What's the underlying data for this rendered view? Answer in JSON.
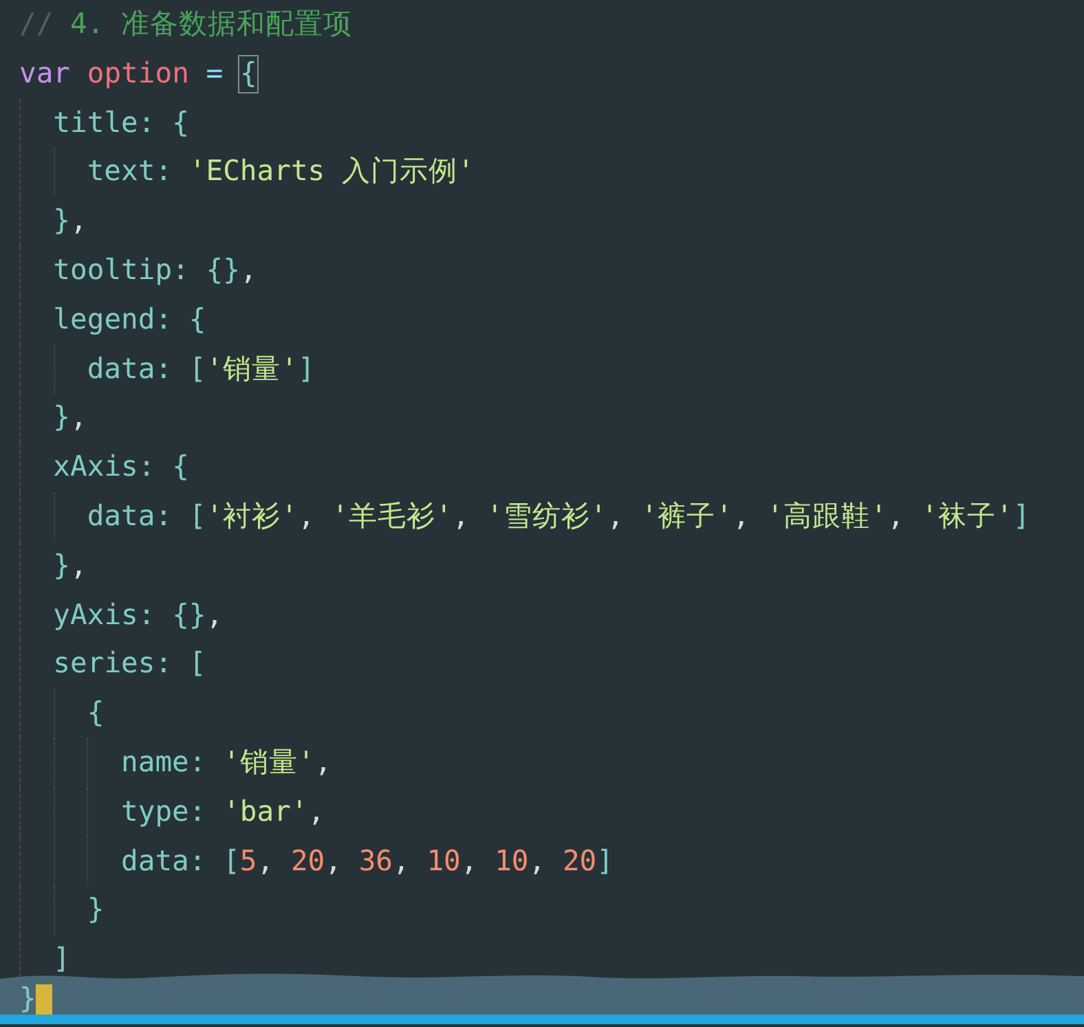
{
  "editor": {
    "lines": [
      {
        "tokens": [
          {
            "kind": "comment-mark",
            "text": "// "
          },
          {
            "kind": "comment",
            "text": "4. 准备数据和配置项"
          }
        ]
      },
      {
        "tokens": [
          {
            "kind": "keyword",
            "text": "var "
          },
          {
            "kind": "variable",
            "text": "option "
          },
          {
            "kind": "operator",
            "text": "= "
          },
          {
            "kind": "bracket",
            "text": "{",
            "highlighted": true
          }
        ],
        "children": [
          {
            "tokens": [
              {
                "kind": "property",
                "text": "title: "
              },
              {
                "kind": "bracket",
                "text": "{"
              }
            ],
            "children": [
              {
                "tokens": [
                  {
                    "kind": "property",
                    "text": "text: "
                  },
                  {
                    "kind": "string",
                    "text": "'ECharts 入门示例'"
                  }
                ]
              }
            ]
          },
          {
            "tokens": [
              {
                "kind": "bracket",
                "text": "}"
              },
              {
                "kind": "punct",
                "text": ","
              }
            ]
          },
          {
            "tokens": [
              {
                "kind": "property",
                "text": "tooltip: "
              },
              {
                "kind": "bracket",
                "text": "{}"
              },
              {
                "kind": "punct",
                "text": ","
              }
            ]
          },
          {
            "tokens": [
              {
                "kind": "property",
                "text": "legend: "
              },
              {
                "kind": "bracket",
                "text": "{"
              }
            ],
            "children": [
              {
                "tokens": [
                  {
                    "kind": "property",
                    "text": "data: "
                  },
                  {
                    "kind": "bracket",
                    "text": "["
                  },
                  {
                    "kind": "string",
                    "text": "'销量'"
                  },
                  {
                    "kind": "bracket",
                    "text": "]"
                  }
                ]
              }
            ]
          },
          {
            "tokens": [
              {
                "kind": "bracket",
                "text": "}"
              },
              {
                "kind": "punct",
                "text": ","
              }
            ]
          },
          {
            "tokens": [
              {
                "kind": "property",
                "text": "xAxis: "
              },
              {
                "kind": "bracket",
                "text": "{"
              }
            ],
            "children": [
              {
                "tokens": [
                  {
                    "kind": "property",
                    "text": "data: "
                  },
                  {
                    "kind": "bracket",
                    "text": "["
                  },
                  {
                    "kind": "string",
                    "text": "'衬衫'"
                  },
                  {
                    "kind": "punct",
                    "text": ", "
                  },
                  {
                    "kind": "string",
                    "text": "'羊毛衫'"
                  },
                  {
                    "kind": "punct",
                    "text": ", "
                  },
                  {
                    "kind": "string",
                    "text": "'雪纺衫'"
                  },
                  {
                    "kind": "punct",
                    "text": ", "
                  },
                  {
                    "kind": "string",
                    "text": "'裤子'"
                  },
                  {
                    "kind": "punct",
                    "text": ", "
                  },
                  {
                    "kind": "string",
                    "text": "'高跟鞋'"
                  },
                  {
                    "kind": "punct",
                    "text": ", "
                  },
                  {
                    "kind": "string",
                    "text": "'袜子'"
                  },
                  {
                    "kind": "bracket",
                    "text": "]"
                  }
                ]
              }
            ]
          },
          {
            "tokens": [
              {
                "kind": "bracket",
                "text": "}"
              },
              {
                "kind": "punct",
                "text": ","
              }
            ]
          },
          {
            "tokens": [
              {
                "kind": "property",
                "text": "yAxis: "
              },
              {
                "kind": "bracket",
                "text": "{}"
              },
              {
                "kind": "punct",
                "text": ","
              }
            ]
          },
          {
            "tokens": [
              {
                "kind": "property",
                "text": "series: "
              },
              {
                "kind": "bracket",
                "text": "["
              }
            ],
            "children": [
              {
                "tokens": [
                  {
                    "kind": "bracket",
                    "text": "{"
                  }
                ],
                "children": [
                  {
                    "tokens": [
                      {
                        "kind": "property",
                        "text": "name: "
                      },
                      {
                        "kind": "string",
                        "text": "'销量'"
                      },
                      {
                        "kind": "punct",
                        "text": ","
                      }
                    ]
                  },
                  {
                    "tokens": [
                      {
                        "kind": "property",
                        "text": "type: "
                      },
                      {
                        "kind": "string",
                        "text": "'bar'"
                      },
                      {
                        "kind": "punct",
                        "text": ","
                      }
                    ]
                  },
                  {
                    "tokens": [
                      {
                        "kind": "property",
                        "text": "data: "
                      },
                      {
                        "kind": "bracket",
                        "text": "["
                      },
                      {
                        "kind": "number",
                        "text": "5"
                      },
                      {
                        "kind": "punct",
                        "text": ", "
                      },
                      {
                        "kind": "number",
                        "text": "20"
                      },
                      {
                        "kind": "punct",
                        "text": ", "
                      },
                      {
                        "kind": "number",
                        "text": "36"
                      },
                      {
                        "kind": "punct",
                        "text": ", "
                      },
                      {
                        "kind": "number",
                        "text": "10"
                      },
                      {
                        "kind": "punct",
                        "text": ", "
                      },
                      {
                        "kind": "number",
                        "text": "10"
                      },
                      {
                        "kind": "punct",
                        "text": ", "
                      },
                      {
                        "kind": "number",
                        "text": "20"
                      },
                      {
                        "kind": "bracket",
                        "text": "]"
                      }
                    ]
                  }
                ]
              },
              {
                "tokens": [
                  {
                    "kind": "bracket",
                    "text": "}"
                  }
                ]
              }
            ]
          },
          {
            "tokens": [
              {
                "kind": "bracket",
                "text": "]"
              }
            ]
          }
        ]
      }
    ],
    "last_line": {
      "tokens": [
        {
          "kind": "bracket",
          "text": "}"
        }
      ],
      "cursor": true
    }
  }
}
